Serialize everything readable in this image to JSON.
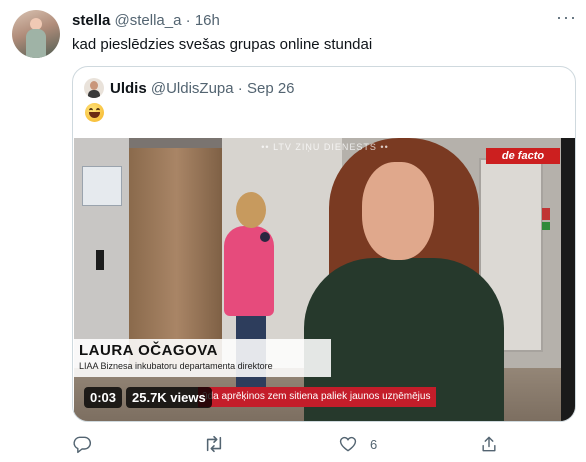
{
  "tweet": {
    "author_name": "stella",
    "author_handle": "@stella_a",
    "separator": "·",
    "time": "16h",
    "more_label": "···",
    "text": "kad pieslēdzies svešas grupas online stundai"
  },
  "quoted": {
    "author_name": "Uldis",
    "author_handle": "@UldisZupa",
    "separator": "·",
    "time": "Sep 26",
    "emoji_icon": "grinning-face-emoji",
    "video": {
      "watermark": "•• LTV ZIŅU DIENESTS ••",
      "channel_badge": "de facto",
      "person_name": "LAURA OČAGOVA",
      "person_title": "LIAA Biznesa inkubatoru departamenta direktore",
      "ticker": "ūda aprēķinos zem sitiena paliek jaunos uzņēmējus",
      "duration": "0:03",
      "views": "25.7K views"
    }
  },
  "actions": {
    "reply_icon": "reply-icon",
    "retweet_icon": "retweet-icon",
    "like_icon": "like-icon",
    "like_count": "6",
    "share_icon": "share-icon"
  },
  "colors": {
    "text_primary": "#0f1419",
    "text_secondary": "#536471",
    "border": "#cfd9de",
    "defacto_red": "#cc1f1f"
  }
}
